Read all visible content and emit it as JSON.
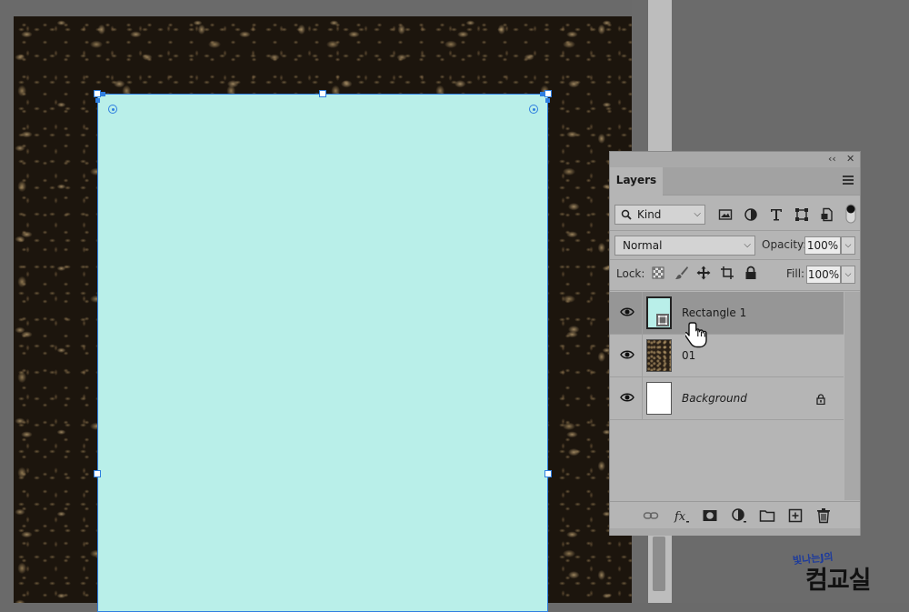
{
  "panel": {
    "title": "Layers",
    "collapse_glyph": "‹‹",
    "close_glyph": "✕",
    "filter_kind": "Kind",
    "blend_mode": "Normal",
    "opacity_label": "Opacity:",
    "opacity_value": "100%",
    "lock_label": "Lock:",
    "fill_label": "Fill:",
    "fill_value": "100%"
  },
  "layers": [
    {
      "name": "Rectangle 1",
      "selected": true,
      "italic": false,
      "locked": false
    },
    {
      "name": "01",
      "selected": false,
      "italic": false,
      "locked": false
    },
    {
      "name": "Background",
      "selected": false,
      "italic": true,
      "locked": true
    }
  ],
  "watermark": {
    "top": "빛나는J의",
    "main": "컴교실"
  },
  "colors": {
    "shape_fill": "#b9efe9",
    "selection_blue": "#2f7fe0",
    "panel_bg": "#b5b5b5",
    "selected_row": "#969696",
    "workspace": "#6a6a6a"
  },
  "icons": [
    "search-icon",
    "image-filter-icon",
    "adjustment-filter-icon",
    "type-filter-icon",
    "shape-filter-icon",
    "smart-object-filter-icon",
    "filter-toggle",
    "lock-pixels-icon",
    "lock-paint-icon",
    "lock-position-icon",
    "lock-artboard-icon",
    "lock-all-icon",
    "eye-icon",
    "lock-icon",
    "link-icon",
    "fx-icon",
    "mask-icon",
    "adjustment-layer-icon",
    "folder-icon",
    "new-layer-icon",
    "trash-icon",
    "hand-cursor-icon"
  ]
}
